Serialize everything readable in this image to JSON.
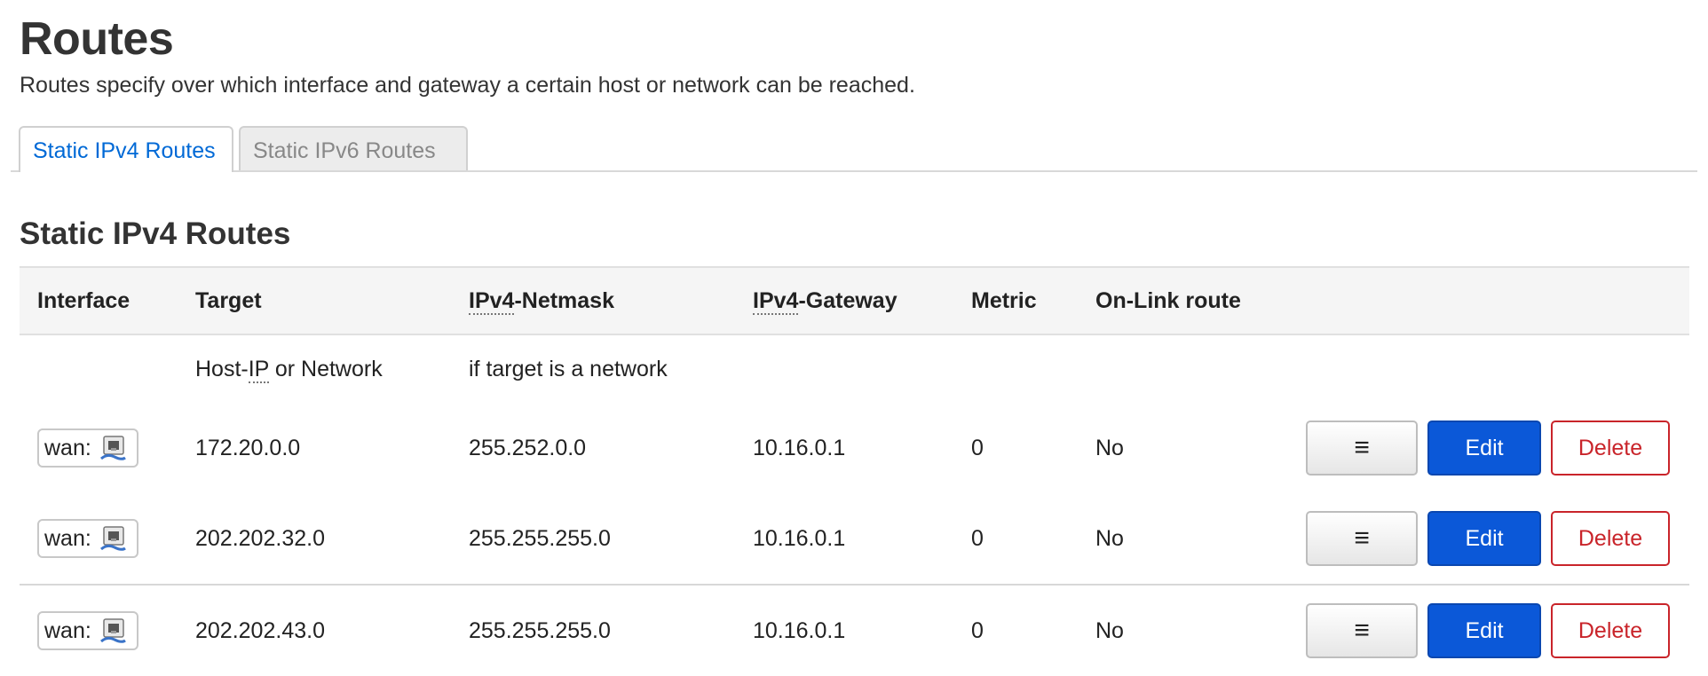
{
  "page": {
    "title": "Routes",
    "description": "Routes specify over which interface and gateway a certain host or network can be reached."
  },
  "tabs": [
    {
      "label": "Static IPv4 Routes",
      "active": true
    },
    {
      "label": "Static IPv6 Routes",
      "active": false
    }
  ],
  "section": {
    "title": "Static IPv4 Routes"
  },
  "table": {
    "headers": {
      "interface": "Interface",
      "target": "Target",
      "netmask_abbr": "IPv4",
      "netmask_rest": "-Netmask",
      "gateway_abbr": "IPv4",
      "gateway_rest": "-Gateway",
      "metric": "Metric",
      "onlink": "On-Link route"
    },
    "descriptions": {
      "target_pre": "Host-",
      "target_abbr": "IP",
      "target_post": " or Network",
      "netmask": "if target is a network"
    },
    "rows": [
      {
        "interface": "wan:",
        "target": "172.20.0.0",
        "netmask": "255.252.0.0",
        "gateway": "10.16.0.1",
        "metric": "0",
        "onlink": "No"
      },
      {
        "interface": "wan:",
        "target": "202.202.32.0",
        "netmask": "255.255.255.0",
        "gateway": "10.16.0.1",
        "metric": "0",
        "onlink": "No"
      },
      {
        "interface": "wan:",
        "target": "202.202.43.0",
        "netmask": "255.255.255.0",
        "gateway": "10.16.0.1",
        "metric": "0",
        "onlink": "No"
      }
    ],
    "buttons": {
      "sort": "≡",
      "edit": "Edit",
      "delete": "Delete"
    },
    "icon_name": "ethernet-port-icon"
  },
  "colors": {
    "accent": "#0069d6",
    "edit_button": "#0b58d8",
    "delete_border": "#c9242a"
  }
}
